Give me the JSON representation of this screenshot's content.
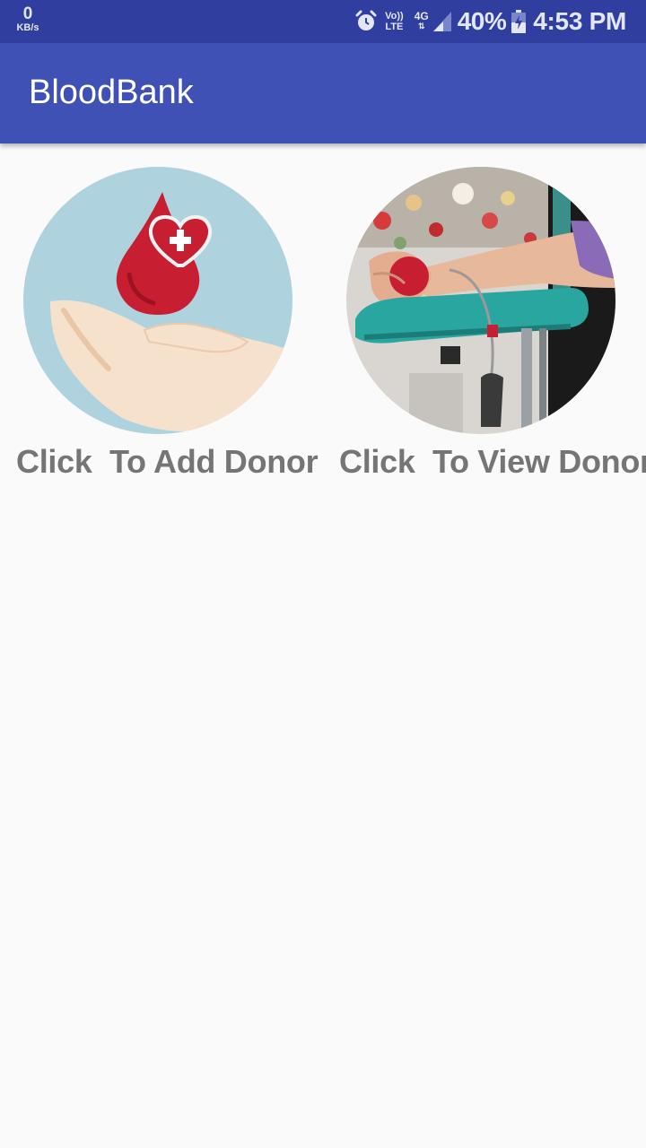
{
  "status_bar": {
    "net_speed_value": "0",
    "net_speed_unit": "KB/s",
    "volte_top": "Vo))",
    "volte_bottom": "LTE",
    "network_type": "4G",
    "battery_percent": "40%",
    "time": "4:53 PM",
    "icons": [
      "alarm-icon",
      "volte-icon",
      "signal-icon",
      "battery-charging-icon"
    ]
  },
  "app_bar": {
    "title": "BloodBank"
  },
  "actions": [
    {
      "caption": "Click  To Add Donor",
      "image": "hand-holding-blood-drop-illustration"
    },
    {
      "caption": "Click  To View Donor",
      "image": "blood-donation-photo"
    }
  ],
  "colors": {
    "status_bar": "#303f9f",
    "app_bar": "#3f51b5",
    "background": "#fafafa",
    "caption_text": "#757575",
    "blood_red": "#c81e32"
  }
}
